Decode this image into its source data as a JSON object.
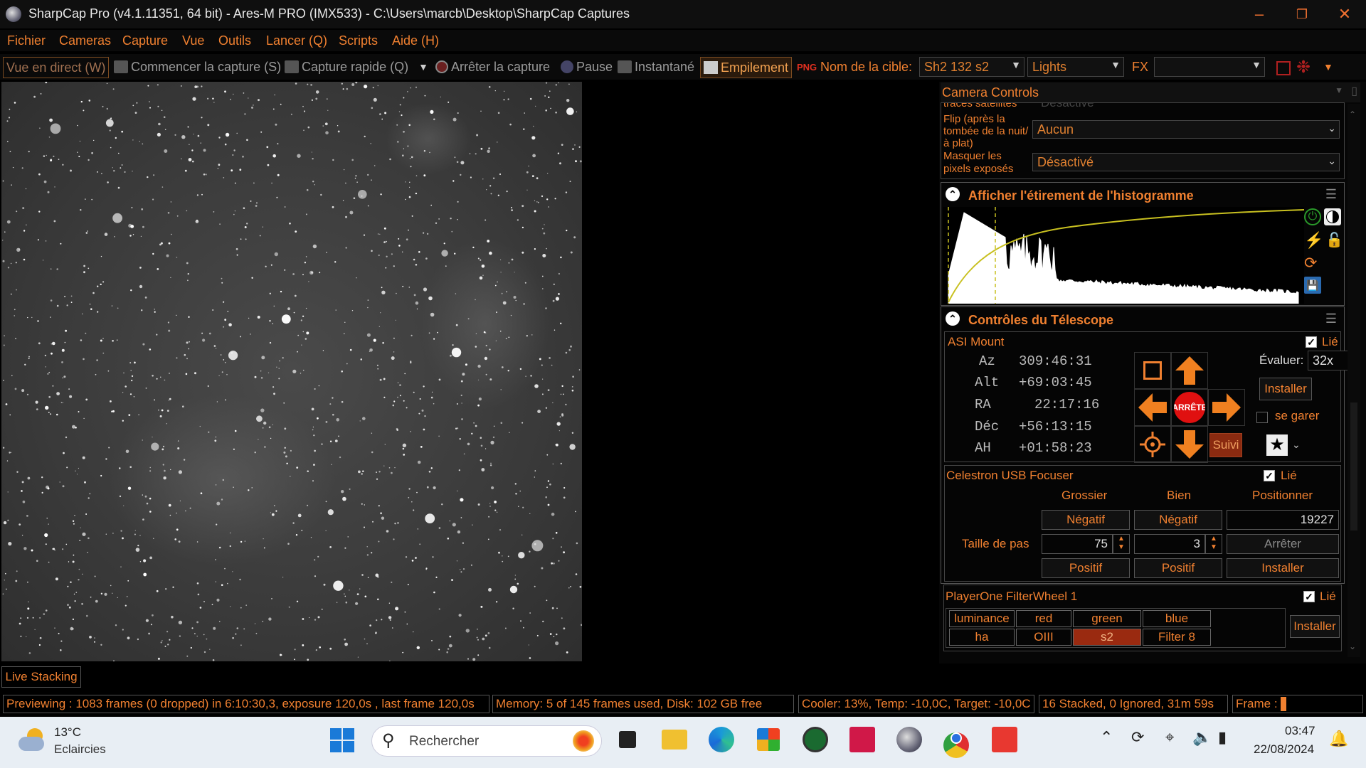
{
  "window": {
    "title": "SharpCap Pro (v4.1.11351, 64 bit) - Ares-M PRO (IMX533) - C:\\Users\\marcb\\Desktop\\SharpCap Captures"
  },
  "menu": [
    "Fichier",
    "Cameras",
    "Capture",
    "Vue",
    "Outils",
    "Lancer (Q)",
    "Scripts",
    "Aide (H)"
  ],
  "toolbar": {
    "live_view": "Vue en direct (W)",
    "start_capture": "Commencer la capture (S)",
    "quick_capture": "Capture rapide (Q)",
    "stop_capture": "Arrêter la capture",
    "pause": "Pause",
    "snapshot": "Instantané",
    "stacking": "Empilement",
    "target_label": "Nom de la cible:",
    "target_value": "Sh2 132 s2",
    "frame_type": "Lights",
    "fx_label": "FX",
    "fx_value": ""
  },
  "camera_controls": {
    "header": "Camera Controls",
    "row_satellite_label": "traces satellites",
    "row_satellite_value": "Désactivé",
    "row_flip_label": "Flip (après la tombée de la nuit/à plat)",
    "row_flip_value": "Aucun",
    "row_mask_label": "Masquer les pixels exposés",
    "row_mask_value": "Désactivé"
  },
  "histogram": {
    "title": "Afficher l'étirement de l'histogramme"
  },
  "telescope": {
    "title": "Contrôles du Télescope",
    "mount_name": "ASI Mount",
    "linked_label": "Lié",
    "coords": [
      {
        "label": "Az",
        "value": "309:46:31"
      },
      {
        "label": "Alt",
        "value": "+69:03:45"
      },
      {
        "label": "RA",
        "value": "22:17:16"
      },
      {
        "label": "Déc",
        "value": "+56:13:15"
      },
      {
        "label": "AH",
        "value": "+01:58:23"
      }
    ],
    "stop_label": "ARRÊTE",
    "rate_label": "Évaluer:",
    "rate_value": "32x",
    "setup_label": "Installer",
    "park_label": "se garer",
    "tracking_label": "Suivi"
  },
  "focuser": {
    "name": "Celestron USB Focuser",
    "linked_label": "Lié",
    "col_coarse": "Grossier",
    "col_fine": "Bien",
    "col_position": "Positionner",
    "neg_label": "Négatif",
    "pos_label": "Positif",
    "step_label": "Taille de pas",
    "coarse_step": "75",
    "fine_step": "3",
    "position_value": "19227",
    "stop_label": "Arrêter",
    "setup_label": "Installer"
  },
  "filterwheel": {
    "name": "PlayerOne FilterWheel 1",
    "linked_label": "Lié",
    "filters": [
      "luminance",
      "red",
      "green",
      "blue",
      "ha",
      "OIII",
      "s2",
      "Filter 8"
    ],
    "selected": "s2",
    "setup_label": "Installer"
  },
  "live_stacking_tab": "Live Stacking",
  "status": {
    "preview": "Previewing : 1083 frames (0 dropped) in 6:10:30,3, exposure 120,0s , last frame 120,0s",
    "memory": "Memory: 5 of 145 frames used, Disk: 102 GB free",
    "cooler": "Cooler: 13%, Temp: -10,0C, Target: -10,0C",
    "stacked": "16 Stacked, 0 Ignored, 31m 59s",
    "frame_label": "Frame :"
  },
  "taskbar": {
    "weather_temp": "13°C",
    "weather_desc": "Eclaircies",
    "search_placeholder": "Rechercher",
    "time": "03:47",
    "date": "22/08/2024"
  },
  "colors": {
    "accent": "#f08030",
    "selected_filter": "#9a2a10",
    "stop_button": "#e01010"
  }
}
